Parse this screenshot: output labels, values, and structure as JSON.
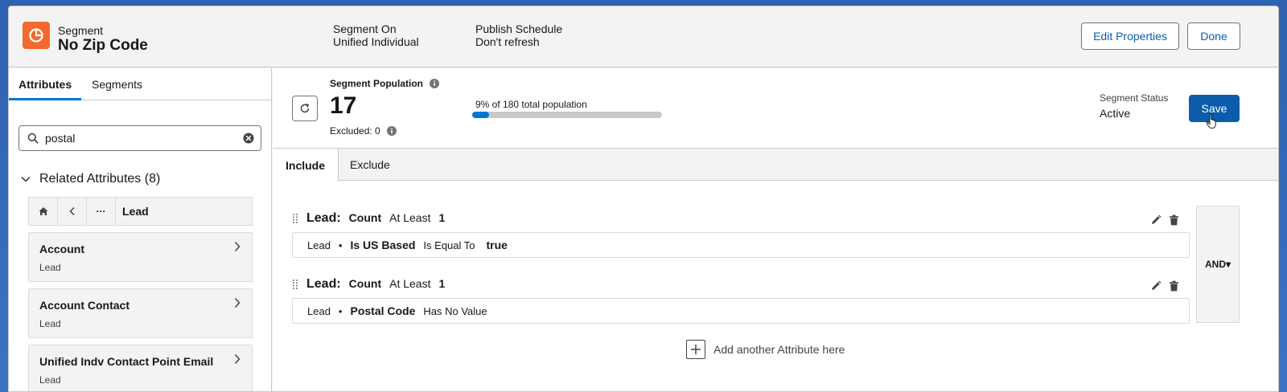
{
  "header": {
    "object_type": "Segment",
    "title": "No Zip Code",
    "segment_on_label": "Segment On",
    "segment_on_value": "Unified Individual",
    "publish_label": "Publish Schedule",
    "publish_value": "Don't refresh",
    "edit_label": "Edit Properties",
    "done_label": "Done"
  },
  "sidebar": {
    "tabs": [
      {
        "label": "Attributes"
      },
      {
        "label": "Segments"
      }
    ],
    "search": {
      "value": "postal"
    },
    "related": {
      "label": "Related Attributes (8)"
    },
    "breadcrumb": {
      "current": "Lead",
      "more": "···"
    },
    "items": [
      {
        "title": "Account",
        "subtitle": "Lead"
      },
      {
        "title": "Account Contact",
        "subtitle": "Lead"
      },
      {
        "title": "Unified Indv Contact Point Email",
        "subtitle": "Lead"
      }
    ]
  },
  "population": {
    "label": "Segment Population",
    "count": "17",
    "excluded": "Excluded: 0",
    "percent_text": "9% of 180 total population",
    "percent_value": 9,
    "status_label": "Segment Status",
    "status_value": "Active",
    "save_label": "Save"
  },
  "canvas": {
    "tabs": [
      {
        "label": "Include"
      },
      {
        "label": "Exclude"
      }
    ],
    "blocks": [
      {
        "object": "Lead:",
        "measure": "Count",
        "operator": "At Least",
        "value": "1",
        "rule": {
          "object": "Lead",
          "bullet": "•",
          "attribute": "Is US Based",
          "operator": "Is Equal To",
          "value": "true"
        }
      },
      {
        "object": "Lead:",
        "measure": "Count",
        "operator": "At Least",
        "value": "1",
        "rule": {
          "object": "Lead",
          "bullet": "•",
          "attribute": "Postal Code",
          "operator": "Has No Value",
          "value": ""
        }
      }
    ],
    "logic": "AND▾",
    "add_label": "Add another Attribute here"
  },
  "colors": {
    "brand_blue": "#0b5cab",
    "accent_blue": "#0176d3",
    "segment_icon": "#f26a30"
  }
}
